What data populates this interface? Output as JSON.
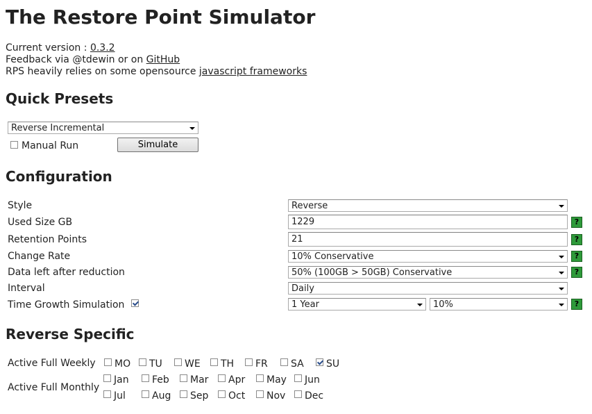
{
  "title": "The Restore Point Simulator",
  "info": {
    "version_prefix": "Current version : ",
    "version": "0.3.2",
    "feedback_prefix": "Feedback via @tdewin or on ",
    "github": "GitHub",
    "rps_prefix": "RPS heavily relies on some opensource ",
    "frameworks": "javascript frameworks"
  },
  "quick_presets": {
    "heading": "Quick Presets",
    "preset_value": "Reverse Incremental",
    "manual_run_label": "Manual Run",
    "manual_run_checked": false,
    "simulate_label": "Simulate"
  },
  "configuration": {
    "heading": "Configuration",
    "style_label": "Style",
    "style_value": "Reverse",
    "used_size_label": "Used Size GB",
    "used_size_value": "1229",
    "retention_label": "Retention Points",
    "retention_value": "21",
    "change_rate_label": "Change Rate",
    "change_rate_value": "10% Conservative",
    "data_left_label": "Data left after reduction",
    "data_left_value": "50% (100GB > 50GB) Conservative",
    "interval_label": "Interval",
    "interval_value": "Daily",
    "time_growth_label": "Time Growth Simulation",
    "time_growth_checked": true,
    "growth_period_value": "1 Year",
    "growth_rate_value": "10%",
    "help_glyph": "?"
  },
  "reverse_specific": {
    "heading": "Reverse Specific",
    "weekly_label": "Active Full Weekly",
    "days": [
      "MO",
      "TU",
      "WE",
      "TH",
      "FR",
      "SA",
      "SU"
    ],
    "days_checked": [
      false,
      false,
      false,
      false,
      false,
      false,
      true
    ],
    "monthly_label": "Active Full Monthly",
    "months_row1": [
      "Jan",
      "Feb",
      "Mar",
      "Apr",
      "May",
      "Jun"
    ],
    "months_row2": [
      "Jul",
      "Aug",
      "Sep",
      "Oct",
      "Nov",
      "Dec"
    ]
  }
}
